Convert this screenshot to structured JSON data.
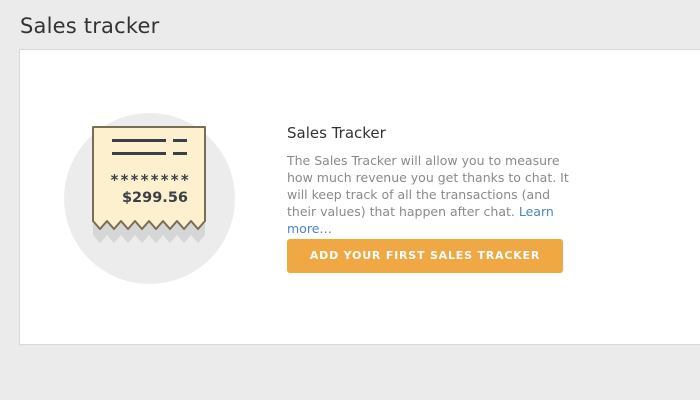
{
  "page": {
    "title": "Sales tracker"
  },
  "card": {
    "heading": "Sales Tracker",
    "description": "The Sales Tracker will allow you to measure how much revenue you get thanks to chat. It will keep track of all the transactions (and their values) that happen after chat.",
    "learn_more": "Learn more…",
    "cta_label": "ADD YOUR FIRST SALES TRACKER"
  },
  "illustration": {
    "icon": "receipt-icon",
    "masked": "********",
    "amount": "$299.56"
  },
  "colors": {
    "background": "#ebebeb",
    "accent": "#efa843",
    "link": "#4a86c5",
    "receipt": "#fdf0cf",
    "circle": "#ececec"
  }
}
